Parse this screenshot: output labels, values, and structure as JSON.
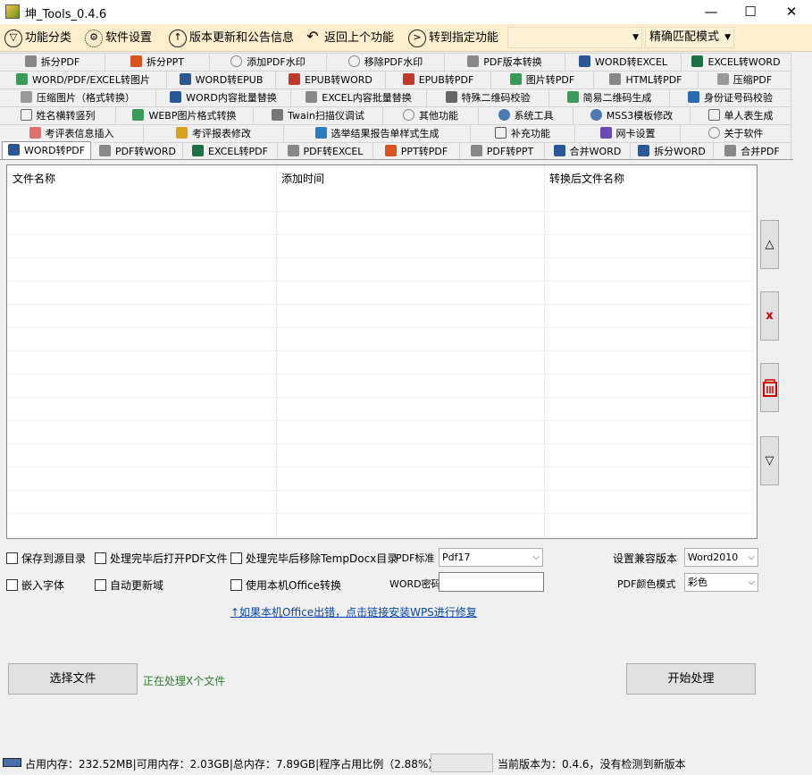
{
  "window": {
    "title": "坤_Tools_0.4.6",
    "minimize": "—",
    "maximize": "☐",
    "close": "✕"
  },
  "menu": {
    "items": [
      {
        "label": "功能分类",
        "icon": "funnel-icon"
      },
      {
        "label": "软件设置",
        "icon": "gear-icon"
      },
      {
        "label": "版本更新和公告信息",
        "icon": "arrow-up-circle-icon"
      },
      {
        "label": "返回上个功能",
        "icon": "back-arrow-icon"
      },
      {
        "label": "转到指定功能",
        "icon": "arrow-right-circle-icon"
      }
    ],
    "search_value": "",
    "match_mode": "精确匹配模式"
  },
  "tabs": {
    "row1": [
      "拆分PDF",
      "拆分PPT",
      "添加PDF水印",
      "移除PDF水印",
      "PDF版本转换",
      "WORD转EXCEL",
      "EXCEL转WORD"
    ],
    "row2": [
      "WORD/PDF/EXCEL转图片",
      "WORD转EPUB",
      "EPUB转WORD",
      "EPUB转PDF",
      "图片转PDF",
      "HTML转PDF",
      "压缩PDF"
    ],
    "row3": [
      "压缩图片（格式转换）",
      "WORD内容批量替换",
      "EXCEL内容批量替换",
      "特殊二维码校验",
      "简易二维码生成",
      "身份证号码校验"
    ],
    "row4": [
      "姓名横转竖列",
      "WEBP图片格式转换",
      "Twain扫描仪调试",
      "其他功能",
      "系统工具",
      "MSS3模板修改",
      "单人表生成"
    ],
    "row5": [
      "考评表信息插入",
      "考评报表修改",
      "选举结果报告单样式生成",
      "补充功能",
      "网卡设置",
      "关于软件"
    ],
    "row6": [
      "WORD转PDF",
      "PDF转WORD",
      "EXCEL转PDF",
      "PDF转EXCEL",
      "PPT转PDF",
      "PDF转PPT",
      "合并WORD",
      "拆分WORD",
      "合并PDF"
    ]
  },
  "grid": {
    "columns": [
      "文件名称",
      "添加时间",
      "转换后文件名称"
    ],
    "rows": []
  },
  "side_buttons": {
    "up": "△",
    "remove": "x",
    "clear": "clear-icon",
    "down": "▽"
  },
  "options": {
    "save_to_source": "保存到源目录",
    "open_pdf_after": "处理完毕后打开PDF文件",
    "remove_temp_after": "处理完毕后移除TempDocx目录",
    "embed_fonts": "嵌入字体",
    "auto_update_fields": "自动更新域",
    "use_local_office": "使用本机Office转换",
    "pdf_standard_label": "PDF标准",
    "pdf_standard_value": "Pdf17",
    "word_password_label": "WORD密码",
    "word_password_value": "",
    "compat_label": "设置兼容版本",
    "compat_value": "Word2010",
    "color_label": "PDF颜色模式",
    "color_value": "彩色"
  },
  "repair_link": "↑如果本机Office出错，点击链接安装WPS进行修复",
  "actions": {
    "select_files": "选择文件",
    "start": "开始处理",
    "processing": "正在处理X个文件"
  },
  "status": {
    "memory": "占用内存：232.52MB|可用内存：2.03GB|总内存：7.89GB|程序占用比例（2.88%）",
    "version": "当前版本为：0.4.6，没有检测到新版本"
  },
  "colors": {
    "menubar": "#fdeecd",
    "link": "#0645ad",
    "processing": "#2f7d2f",
    "remove": "#d00000"
  }
}
